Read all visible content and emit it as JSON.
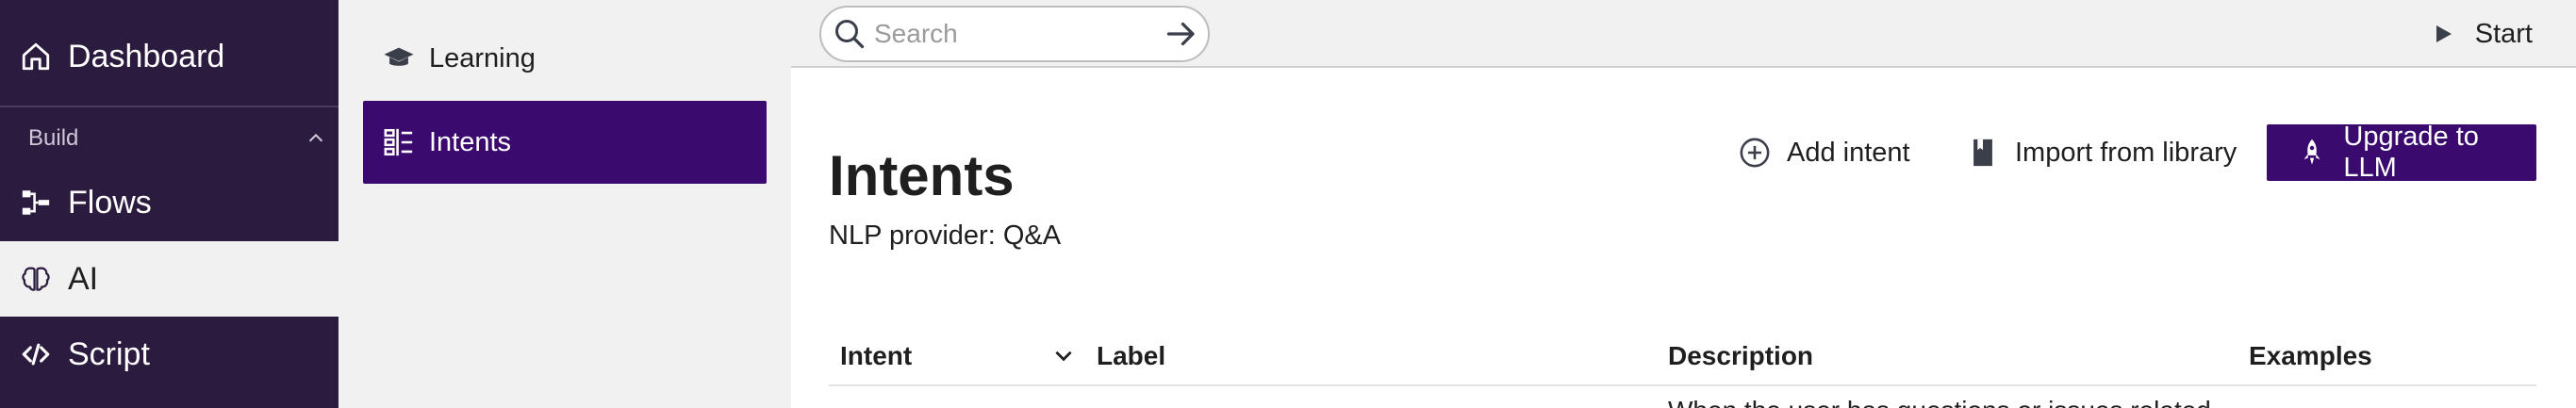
{
  "leftnav": {
    "dashboard": "Dashboard",
    "section_build": "Build",
    "flows": "Flows",
    "ai": "AI",
    "script": "Script"
  },
  "subnav": {
    "learning": "Learning",
    "intents": "Intents"
  },
  "topbar": {
    "search_placeholder": "Search",
    "start": "Start"
  },
  "main": {
    "title": "Intents",
    "nlp_provider": "NLP provider: Q&A",
    "actions": {
      "add_intent": "Add intent",
      "import_library": "Import from library",
      "upgrade": "Upgrade to LLM"
    },
    "table": {
      "columns": [
        "Intent",
        "Label",
        "Description",
        "Examples"
      ],
      "first_row_description_partial": "When the user has questions or issues related"
    }
  },
  "colors": {
    "nav_bg": "#2b1b3e",
    "accent_purple": "#3b0a6e"
  },
  "icons": [
    "home-icon",
    "chevron-up-icon",
    "flows-icon",
    "brain-icon",
    "code-icon",
    "graduation-cap-icon",
    "intents-icon",
    "search-icon",
    "arrow-right-icon",
    "play-icon",
    "plus-circle-icon",
    "book-icon",
    "rocket-icon",
    "chevron-down-icon"
  ]
}
